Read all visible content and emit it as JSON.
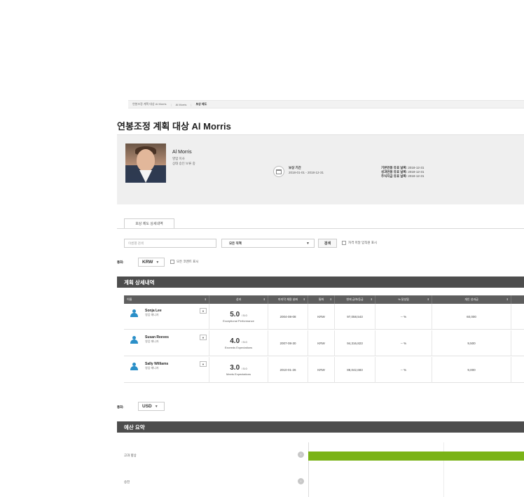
{
  "breadcrumb": [
    "연봉조정 계획 대상 Al Morris",
    "Al Morris",
    "보상 제도"
  ],
  "page_title": "연봉조정 계획 대상 Al Morris",
  "profile": {
    "name": "Al Morris",
    "title": "영업 이사",
    "status": "상태 승인 보류 중",
    "period_label": "보상 기간",
    "period_value": "2018-01-01 - 2018-12-31",
    "expiry": [
      {
        "label": "기본연봉 유효 날짜:",
        "value": "2018-12-31"
      },
      {
        "label": "성과연봉 유효 날짜:",
        "value": "2018-12-31"
      },
      {
        "label": "주식지급 유효 날짜:",
        "value": "2018-12-31"
      }
    ]
  },
  "tabs": {
    "details": "보상 제도 상세내역"
  },
  "filters": {
    "search_placeholder": "이름별 검색",
    "role_select": "모든 직책",
    "search_button": "검색",
    "ineligible_label": "자격 미달 임직원 표시",
    "currency_label": "통화:",
    "currency_value": "KRW",
    "show_comments_label": "모든 코멘트 표시"
  },
  "plan_section": {
    "title": "계획 상세내역",
    "columns": [
      "이름",
      "성과",
      "마지막 채용 날짜",
      "통화",
      "현재 급여/등급",
      "% 달성됨",
      "개인 성과급"
    ],
    "rows": [
      {
        "name": "Sonja Lee",
        "role": "영업 매니저",
        "score": "5.0",
        "scale": "/ 5.0",
        "rating_desc": "Exceptional Performance",
        "hire_date": "2004-08-08",
        "currency": "KRW",
        "salary": "97,058,543",
        "achieved": "-- %",
        "bonus": "60,000"
      },
      {
        "name": "Susan Reeves",
        "role": "영업 매니저",
        "score": "4.0",
        "scale": "/ 5.0",
        "rating_desc": "Exceeds Expectations",
        "hire_date": "2007-08-30",
        "currency": "KRW",
        "salary": "94,316,823",
        "achieved": "-- %",
        "bonus": "9,500"
      },
      {
        "name": "Sally Williams",
        "role": "영업 매니저",
        "score": "3.0",
        "scale": "/ 5.0",
        "rating_desc": "Meets Expectations",
        "hire_date": "2010-01-26",
        "currency": "KRW",
        "salary": "88,042,683",
        "achieved": "-- %",
        "bonus": "9,000"
      }
    ]
  },
  "budget": {
    "currency_label": "통화:",
    "currency_value": "USD",
    "title": "예산 요약",
    "rows": [
      {
        "label": "고과 향상",
        "fill": 1.0
      },
      {
        "label": "승진",
        "fill": 0
      }
    ]
  },
  "colors": {
    "section_bar": "#4d4d4d",
    "accent_blue": "#2a8fc8",
    "budget_green": "#7ab317"
  }
}
